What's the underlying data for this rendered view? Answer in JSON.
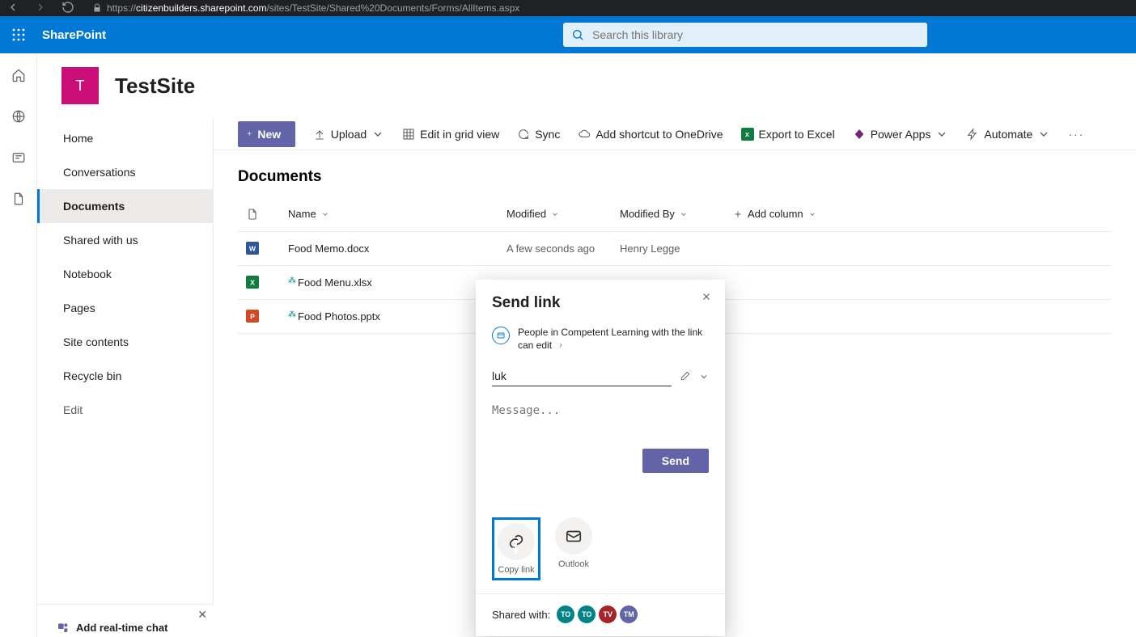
{
  "browser": {
    "url_host": "citizenbuilders.sharepoint.com",
    "url_path": "/sites/TestSite/Shared%20Documents/Forms/AllItems.aspx"
  },
  "suite": {
    "brand": "SharePoint",
    "search_placeholder": "Search this library"
  },
  "site": {
    "logo_letter": "T",
    "title": "TestSite"
  },
  "nav": {
    "items": [
      "Home",
      "Conversations",
      "Documents",
      "Shared with us",
      "Notebook",
      "Pages",
      "Site contents",
      "Recycle bin"
    ],
    "edit": "Edit",
    "selected_index": 2
  },
  "cmdbar": {
    "new": "New",
    "upload": "Upload",
    "grid": "Edit in grid view",
    "sync": "Sync",
    "shortcut": "Add shortcut to OneDrive",
    "excel": "Export to Excel",
    "powerapps": "Power Apps",
    "automate": "Automate"
  },
  "list": {
    "title": "Documents",
    "headers": {
      "name": "Name",
      "modified": "Modified",
      "modified_by": "Modified By",
      "add_column": "Add column"
    },
    "rows": [
      {
        "icon": "word",
        "name": "Food Memo.docx",
        "new": false,
        "modified": "A few seconds ago",
        "by": "Henry Legge"
      },
      {
        "icon": "excel",
        "name": "Food Menu.xlsx",
        "new": true,
        "modified": "",
        "by": ""
      },
      {
        "icon": "ppt",
        "name": "Food Photos.pptx",
        "new": true,
        "modified": "",
        "by": ""
      }
    ]
  },
  "dialog": {
    "title": "Send link",
    "perm_text": "People in Competent Learning with the link can edit",
    "recipient_value": "luk",
    "message_placeholder": "Message...",
    "send": "Send",
    "copy_link": "Copy link",
    "outlook": "Outlook",
    "shared_with_label": "Shared with:",
    "avatars": [
      {
        "initials": "TO",
        "color": "#038387"
      },
      {
        "initials": "TO",
        "color": "#038387"
      },
      {
        "initials": "TV",
        "color": "#a4262c"
      },
      {
        "initials": "TM",
        "color": "#6264a7"
      }
    ]
  },
  "promo": {
    "title": "Add real-time chat"
  }
}
